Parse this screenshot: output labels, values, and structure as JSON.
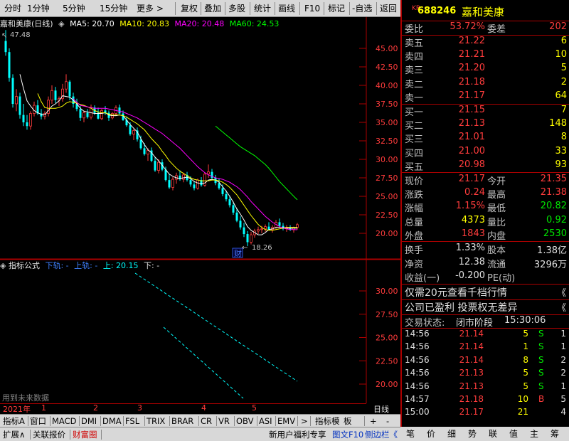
{
  "toolbar": {
    "items": [
      "分时",
      "1分钟",
      "5分钟",
      "15分钟",
      "更多 >",
      "复权",
      "叠加",
      "多股",
      "统计",
      "画线",
      "F10",
      "标记",
      "-自选",
      "返回"
    ]
  },
  "chart": {
    "title": "嘉和美康(日线)",
    "ma5": "MA5: 20.70",
    "ma10": "MA10: 20.83",
    "ma20": "MA20: 20.48",
    "ma60": "MA60: 24.53",
    "high_label": "47.48",
    "low_label": "18.26",
    "cai": "财",
    "y_ticks": [
      "45.00",
      "42.50",
      "40.00",
      "37.50",
      "35.00",
      "32.50",
      "30.00",
      "27.50",
      "25.00",
      "22.50",
      "20.00"
    ],
    "ind_title": "指标公式",
    "ind_lower": "下轨: -",
    "ind_upper": "上轨: -",
    "ind_up": "上: 20.15",
    "ind_down": "下: -",
    "ind_ticks": [
      "30.00",
      "27.50",
      "25.00",
      "22.50",
      "20.00"
    ],
    "future_note": "用到未来数据",
    "x_year": "2021年",
    "x_ticks": [
      "1",
      "2",
      "3",
      "4",
      "5"
    ],
    "period": "日线"
  },
  "chart_data": {
    "type": "candlestick",
    "ylim": [
      18,
      47.5
    ],
    "candles": [
      [
        46,
        47.48,
        44,
        44.5
      ],
      [
        44.5,
        45,
        40.5,
        41
      ],
      [
        41,
        41.5,
        37,
        37.5
      ],
      [
        37.5,
        39.5,
        36.5,
        38.5
      ],
      [
        38.5,
        39,
        35.5,
        36
      ],
      [
        36,
        37.5,
        34.5,
        35
      ],
      [
        35,
        36,
        34,
        34.5
      ],
      [
        34.5,
        36.5,
        34,
        36.2
      ],
      [
        36.2,
        37.8,
        35.8,
        37.3
      ],
      [
        37.3,
        38,
        36,
        36.2
      ],
      [
        36.2,
        36.8,
        35.4,
        35.8
      ],
      [
        35.8,
        36.5,
        35.4,
        36.2
      ],
      [
        36.2,
        38.5,
        35.8,
        38
      ],
      [
        38,
        40,
        37.5,
        39.3
      ],
      [
        39.3,
        39.8,
        37.6,
        38
      ],
      [
        38,
        38.5,
        37.2,
        38.2
      ],
      [
        38.2,
        40.2,
        37.8,
        39.5
      ],
      [
        39.5,
        41.5,
        39,
        40.5
      ],
      [
        40.5,
        40.7,
        38,
        38.5
      ],
      [
        38.5,
        39,
        37,
        37.5
      ],
      [
        37.5,
        38.2,
        36.5,
        36.8
      ],
      [
        36.8,
        37.2,
        35.2,
        35.6
      ],
      [
        35.6,
        36.6,
        35,
        36.3
      ],
      [
        36.3,
        36.8,
        35.5,
        35.7
      ],
      [
        35.7,
        37.4,
        35.4,
        37
      ],
      [
        37,
        37.3,
        36,
        36.3
      ],
      [
        36.3,
        37,
        35.4,
        35.5
      ],
      [
        35.5,
        36.8,
        35.3,
        36.6
      ],
      [
        36.6,
        37.2,
        36,
        36.3
      ],
      [
        36.3,
        36.6,
        35.2,
        35.6
      ],
      [
        35.6,
        36.4,
        35.4,
        36.2
      ],
      [
        36.2,
        37.3,
        35.9,
        37
      ],
      [
        37,
        37.4,
        36.1,
        36.2
      ],
      [
        36.2,
        36.6,
        35.2,
        35.3
      ],
      [
        35.3,
        35.8,
        34.4,
        34.6
      ],
      [
        34.6,
        35,
        33.2,
        33.4
      ],
      [
        33.4,
        34.2,
        32.6,
        33.9
      ],
      [
        33.9,
        34.3,
        32.4,
        32.7
      ],
      [
        32.7,
        33.2,
        31.3,
        31.5
      ],
      [
        31.5,
        32.2,
        30.5,
        30.7
      ],
      [
        30.7,
        31.5,
        29.8,
        31.2
      ],
      [
        31.2,
        31.6,
        29.6,
        29.8
      ],
      [
        29.8,
        30.3,
        28.3,
        28.5
      ],
      [
        28.5,
        30,
        28.1,
        29.6
      ],
      [
        29.6,
        30,
        28.4,
        28.6
      ],
      [
        28.6,
        29,
        27,
        27.2
      ],
      [
        27.2,
        28,
        26,
        26.2
      ],
      [
        26.2,
        27.6,
        25.8,
        27.3
      ],
      [
        27.3,
        28.2,
        26.7,
        27.8
      ],
      [
        27.8,
        28.5,
        27.1,
        27.3
      ],
      [
        27.3,
        28.2,
        26.9,
        27.9
      ],
      [
        27.9,
        28.3,
        27,
        27.2
      ],
      [
        27.2,
        27.7,
        26.3,
        26.6
      ],
      [
        26.6,
        27,
        25.8,
        26.1
      ],
      [
        26.1,
        27.4,
        25.9,
        27.2
      ],
      [
        27.2,
        27.6,
        26.3,
        26.5
      ],
      [
        26.5,
        28.2,
        26.3,
        28
      ],
      [
        28,
        29.3,
        27.5,
        28.3
      ],
      [
        28.3,
        28.7,
        27.2,
        27.5
      ],
      [
        27.5,
        27.9,
        26.5,
        26.8
      ],
      [
        26.8,
        27.4,
        25.9,
        26.1
      ],
      [
        26.1,
        26.6,
        25,
        25.3
      ],
      [
        25.3,
        25.8,
        24.3,
        24.6
      ],
      [
        24.6,
        25.1,
        23.5,
        23.8
      ],
      [
        23.8,
        24.3,
        22.5,
        22.8
      ],
      [
        22.8,
        23.4,
        21.5,
        21.7
      ],
      [
        21.7,
        22.3,
        20.5,
        20.8
      ],
      [
        20.8,
        21.4,
        19.5,
        19.9
      ],
      [
        19.9,
        20.3,
        18.26,
        18.8
      ],
      [
        18.8,
        20.2,
        18.5,
        19.8
      ],
      [
        19.8,
        20.6,
        19.4,
        20.3
      ],
      [
        20.3,
        20.9,
        19.9,
        20.5
      ],
      [
        20.5,
        21,
        20,
        20.6
      ],
      [
        20.6,
        21.2,
        20.2,
        20.9
      ],
      [
        20.9,
        21.5,
        20.4,
        20.5
      ],
      [
        20.5,
        21.1,
        20.1,
        20.8
      ],
      [
        20.8,
        21.8,
        20.6,
        21.5
      ],
      [
        21.5,
        22,
        20.8,
        21
      ],
      [
        21,
        21.4,
        20.4,
        20.6
      ],
      [
        20.6,
        21.1,
        20.2,
        20.8
      ],
      [
        20.8,
        21.1,
        20.3,
        20.5
      ],
      [
        20.5,
        20.9,
        20.1,
        20.8
      ],
      [
        20.8,
        21.4,
        20.5,
        21.17
      ]
    ],
    "series": [
      {
        "name": "MA5",
        "color": "#ffffff",
        "values": [
          null,
          null,
          null,
          null,
          41.5,
          39.6,
          37.9,
          37.2,
          36.6,
          36.3,
          36.1,
          36,
          36.6,
          37.2,
          37.5,
          37.9,
          38.6,
          38.5,
          38.4,
          38,
          37.5,
          36.9,
          36.5,
          36.4,
          36.3,
          36.2,
          36.2,
          36.2,
          36.3,
          36,
          35.9,
          35.9,
          36,
          35.9,
          35.3,
          34.7,
          34.2,
          33.7,
          32.8,
          32,
          31.3,
          30.9,
          30.3,
          29.8,
          29.2,
          28.6,
          28,
          27.7,
          27.5,
          27.4,
          27.5,
          27.6,
          27.4,
          27,
          26.8,
          26.7,
          26.8,
          27.2,
          27.3,
          27.2,
          26.9,
          26.3,
          25.7,
          25,
          24.2,
          23.3,
          22.6,
          21.8,
          20.9,
          20.4,
          20.1,
          19.8,
          19.8,
          20.1,
          20.5,
          20.6,
          20.8,
          20.8,
          20.8,
          20.7,
          20.7,
          20.7,
          20.7
        ]
      },
      {
        "name": "MA10",
        "color": "#ffff00",
        "values": [
          null,
          null,
          null,
          null,
          null,
          null,
          null,
          null,
          null,
          38.9,
          37.8,
          37,
          36.9,
          36.9,
          36.9,
          37,
          37.2,
          37.6,
          37.8,
          37.7,
          37.6,
          37.4,
          37.3,
          37.1,
          36.9,
          36.6,
          36.4,
          36.3,
          36.3,
          36.1,
          36,
          36,
          36,
          35.9,
          35.7,
          35.4,
          35.1,
          34.8,
          34.4,
          34,
          33.4,
          32.8,
          32.3,
          31.8,
          31.1,
          30.5,
          29.8,
          29.3,
          28.8,
          28.4,
          28.1,
          27.8,
          27.5,
          27.3,
          27.2,
          27.1,
          27.1,
          27.1,
          27.2,
          27.2,
          27.1,
          26.9,
          26.6,
          26.2,
          25.7,
          25.2,
          24.5,
          23.8,
          23.1,
          22.4,
          21.8,
          21.2,
          20.8,
          20.5,
          20.4,
          20.4,
          20.5,
          20.6,
          20.7,
          20.8,
          20.8,
          20.8,
          20.8
        ]
      },
      {
        "name": "MA20",
        "color": "#ff00ff",
        "values": [
          null,
          null,
          null,
          null,
          null,
          null,
          null,
          null,
          null,
          null,
          null,
          null,
          null,
          null,
          null,
          null,
          null,
          null,
          null,
          38.2,
          37.7,
          37.3,
          37.2,
          37.1,
          37,
          36.9,
          36.9,
          36.9,
          36.9,
          36.8,
          36.7,
          36.6,
          36.5,
          36.4,
          36.2,
          36,
          35.8,
          35.6,
          35.3,
          35,
          34.7,
          34.4,
          34.1,
          33.8,
          33.5,
          33.1,
          32.7,
          32.3,
          31.9,
          31.5,
          31,
          30.5,
          30,
          29.5,
          29,
          28.6,
          28.2,
          27.9,
          27.7,
          27.5,
          27.4,
          27.3,
          27.1,
          26.9,
          26.6,
          26.3,
          25.9,
          25.4,
          24.9,
          24.3,
          23.8,
          23.3,
          22.8,
          22.3,
          21.9,
          21.5,
          21.2,
          20.9,
          20.7,
          20.6,
          20.5,
          20.5,
          20.48
        ]
      },
      {
        "name": "MA60",
        "color": "#00ff00",
        "values": [
          null,
          null,
          null,
          null,
          null,
          null,
          null,
          null,
          null,
          null,
          null,
          null,
          null,
          null,
          null,
          null,
          null,
          null,
          null,
          null,
          null,
          null,
          null,
          null,
          null,
          null,
          null,
          null,
          null,
          null,
          null,
          null,
          null,
          null,
          null,
          null,
          null,
          null,
          null,
          null,
          null,
          null,
          null,
          null,
          null,
          null,
          null,
          null,
          null,
          null,
          null,
          null,
          null,
          null,
          null,
          null,
          null,
          null,
          null,
          34.5,
          34.1,
          33.7,
          33.3,
          32.9,
          32.5,
          32.1,
          31.7,
          31.4,
          31.1,
          30.8,
          30.5,
          30.1,
          29.7,
          29.3,
          28.8,
          28.2,
          27.6,
          27,
          26.5,
          26,
          25.5,
          25,
          24.53
        ]
      }
    ]
  },
  "stock": {
    "code_prefix": "KR",
    "code": "688246",
    "name": "嘉和美康"
  },
  "quote": {
    "weibi_label": "委比",
    "weibi": "53.72%",
    "weicha_label": "委差",
    "weicha": "202",
    "asks": [
      {
        "label": "卖五",
        "price": "21.22",
        "vol": "6"
      },
      {
        "label": "卖四",
        "price": "21.21",
        "vol": "10"
      },
      {
        "label": "卖三",
        "price": "21.20",
        "vol": "5"
      },
      {
        "label": "卖二",
        "price": "21.18",
        "vol": "2"
      },
      {
        "label": "卖一",
        "price": "21.17",
        "vol": "64"
      }
    ],
    "bids": [
      {
        "label": "买一",
        "price": "21.15",
        "vol": "7"
      },
      {
        "label": "买二",
        "price": "21.13",
        "vol": "148"
      },
      {
        "label": "买三",
        "price": "21.01",
        "vol": "8"
      },
      {
        "label": "买四",
        "price": "21.00",
        "vol": "33"
      },
      {
        "label": "买五",
        "price": "20.98",
        "vol": "93"
      }
    ],
    "stats": [
      {
        "l1": "现价",
        "v1": "21.17",
        "c1": "red",
        "l2": "今开",
        "v2": "21.35",
        "c2": "red"
      },
      {
        "l1": "涨跌",
        "v1": "0.24",
        "c1": "red",
        "l2": "最高",
        "v2": "21.38",
        "c2": "red"
      },
      {
        "l1": "涨幅",
        "v1": "1.15%",
        "c1": "red",
        "l2": "最低",
        "v2": "20.82",
        "c2": "green"
      },
      {
        "l1": "总量",
        "v1": "4373",
        "c1": "yel",
        "l2": "量比",
        "v2": "0.92",
        "c2": "green"
      },
      {
        "l1": "外盘",
        "v1": "1843",
        "c1": "red",
        "l2": "内盘",
        "v2": "2530",
        "c2": "green"
      }
    ],
    "stats2": [
      {
        "l1": "换手",
        "v1": "1.33%",
        "l2": "股本",
        "v2": "1.38亿"
      },
      {
        "l1": "净资",
        "v1": "12.38",
        "l2": "流通",
        "v2": "3296万"
      },
      {
        "l1": "收益(一)",
        "v1": "-0.200",
        "l2": "PE(动)",
        "v2": ""
      }
    ],
    "promo1": "仅需20元查看千档行情",
    "promo1_arrow": "《",
    "promo2": "公司已盈利 投票权无差异",
    "promo2_arrow": "《",
    "status_label": "交易状态:",
    "status_value": "闭市阶段",
    "status_time": "15:30:06",
    "ticks": [
      {
        "t": "14:56",
        "p": "21.14",
        "v": "5",
        "s": "S",
        "n": "1"
      },
      {
        "t": "14:56",
        "p": "21.14",
        "v": "1",
        "s": "S",
        "n": "1"
      },
      {
        "t": "14:56",
        "p": "21.14",
        "v": "8",
        "s": "S",
        "n": "2"
      },
      {
        "t": "14:56",
        "p": "21.13",
        "v": "5",
        "s": "S",
        "n": "2"
      },
      {
        "t": "14:56",
        "p": "21.13",
        "v": "5",
        "s": "S",
        "n": "1"
      },
      {
        "t": "14:57",
        "p": "21.18",
        "v": "10",
        "s": "B",
        "n": "5"
      },
      {
        "t": "15:00",
        "p": "21.17",
        "v": "21",
        "s": "",
        "n": "4"
      }
    ]
  },
  "bottom": {
    "tabs": [
      "指标A",
      "窗口",
      "MACD",
      "DMI",
      "DMA",
      "FSL",
      "TRIX",
      "BRAR",
      "CR",
      "VR",
      "OBV",
      "ASI",
      "EMV",
      ">",
      "指标模",
      "板",
      "+",
      "-"
    ],
    "tabs2": [
      "扩展∧",
      "关联报价",
      "财富圈"
    ],
    "promo": "新用户福利专享",
    "promo2": "图文F10",
    "promo3": "侧边栏《"
  },
  "right_buttons": [
    "笔",
    "价",
    "细",
    "势",
    "联",
    "值",
    "主",
    "筹"
  ]
}
